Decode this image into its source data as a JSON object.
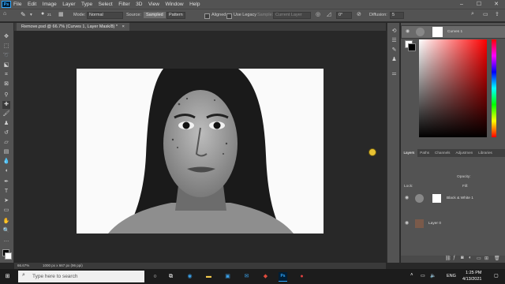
{
  "menubar": {
    "app_logo": "Ps",
    "items": [
      "File",
      "Edit",
      "Image",
      "Layer",
      "Type",
      "Select",
      "Filter",
      "3D",
      "View",
      "Window",
      "Help"
    ],
    "window_controls": [
      "minimize-icon",
      "maximize-icon",
      "close-icon"
    ]
  },
  "options_bar": {
    "brush_size": "21",
    "mode_label": "Mode:",
    "mode_value": "Normal",
    "source_label": "Source:",
    "source_sampled": "Sampled",
    "source_pattern": "Pattern",
    "aligned_label": "Aligned",
    "use_legacy_label": "Use Legacy",
    "sample_label": "Sample:",
    "sample_value": "Current Layer",
    "angle_value": "0°",
    "diffusion_label": "Diffusion:",
    "diffusion_value": "5"
  },
  "document": {
    "tab_title": "Remove.psd @ 66.7% (Curves 1, Layer Mask/8) *",
    "close": "×"
  },
  "statusbar": {
    "zoom": "66.67%",
    "doc_info": "1000 px x 667 px (96 ppi)"
  },
  "color_panel": {
    "tabs": [
      "Color",
      "Swatches",
      "Gradients",
      "Patterns"
    ],
    "active_tab": "Color"
  },
  "layers_panel": {
    "tabs": [
      "Layers",
      "Paths",
      "Channels",
      "Adjustmen",
      "Libraries"
    ],
    "filter_value": "Kind",
    "blend_mode": "Normal",
    "opacity_label": "Opacity:",
    "opacity_value": "100%",
    "lock_label": "Lock:",
    "fill_label": "Fill:",
    "fill_value": "100%",
    "layers": [
      {
        "name": "Black & White 1",
        "selected": false
      },
      {
        "name": "Curves 1",
        "selected": true
      },
      {
        "name": "Layer 0",
        "selected": false
      }
    ]
  },
  "taskbar": {
    "search_placeholder": "Type here to search",
    "language": "ENG",
    "time": "1:25 PM",
    "date": "4/13/2021"
  },
  "colors": {
    "ui_panel": "#535353",
    "canvas_bg": "#282828",
    "accent_blue": "#31a8ff",
    "cursor_yellow": "#e8c232"
  }
}
